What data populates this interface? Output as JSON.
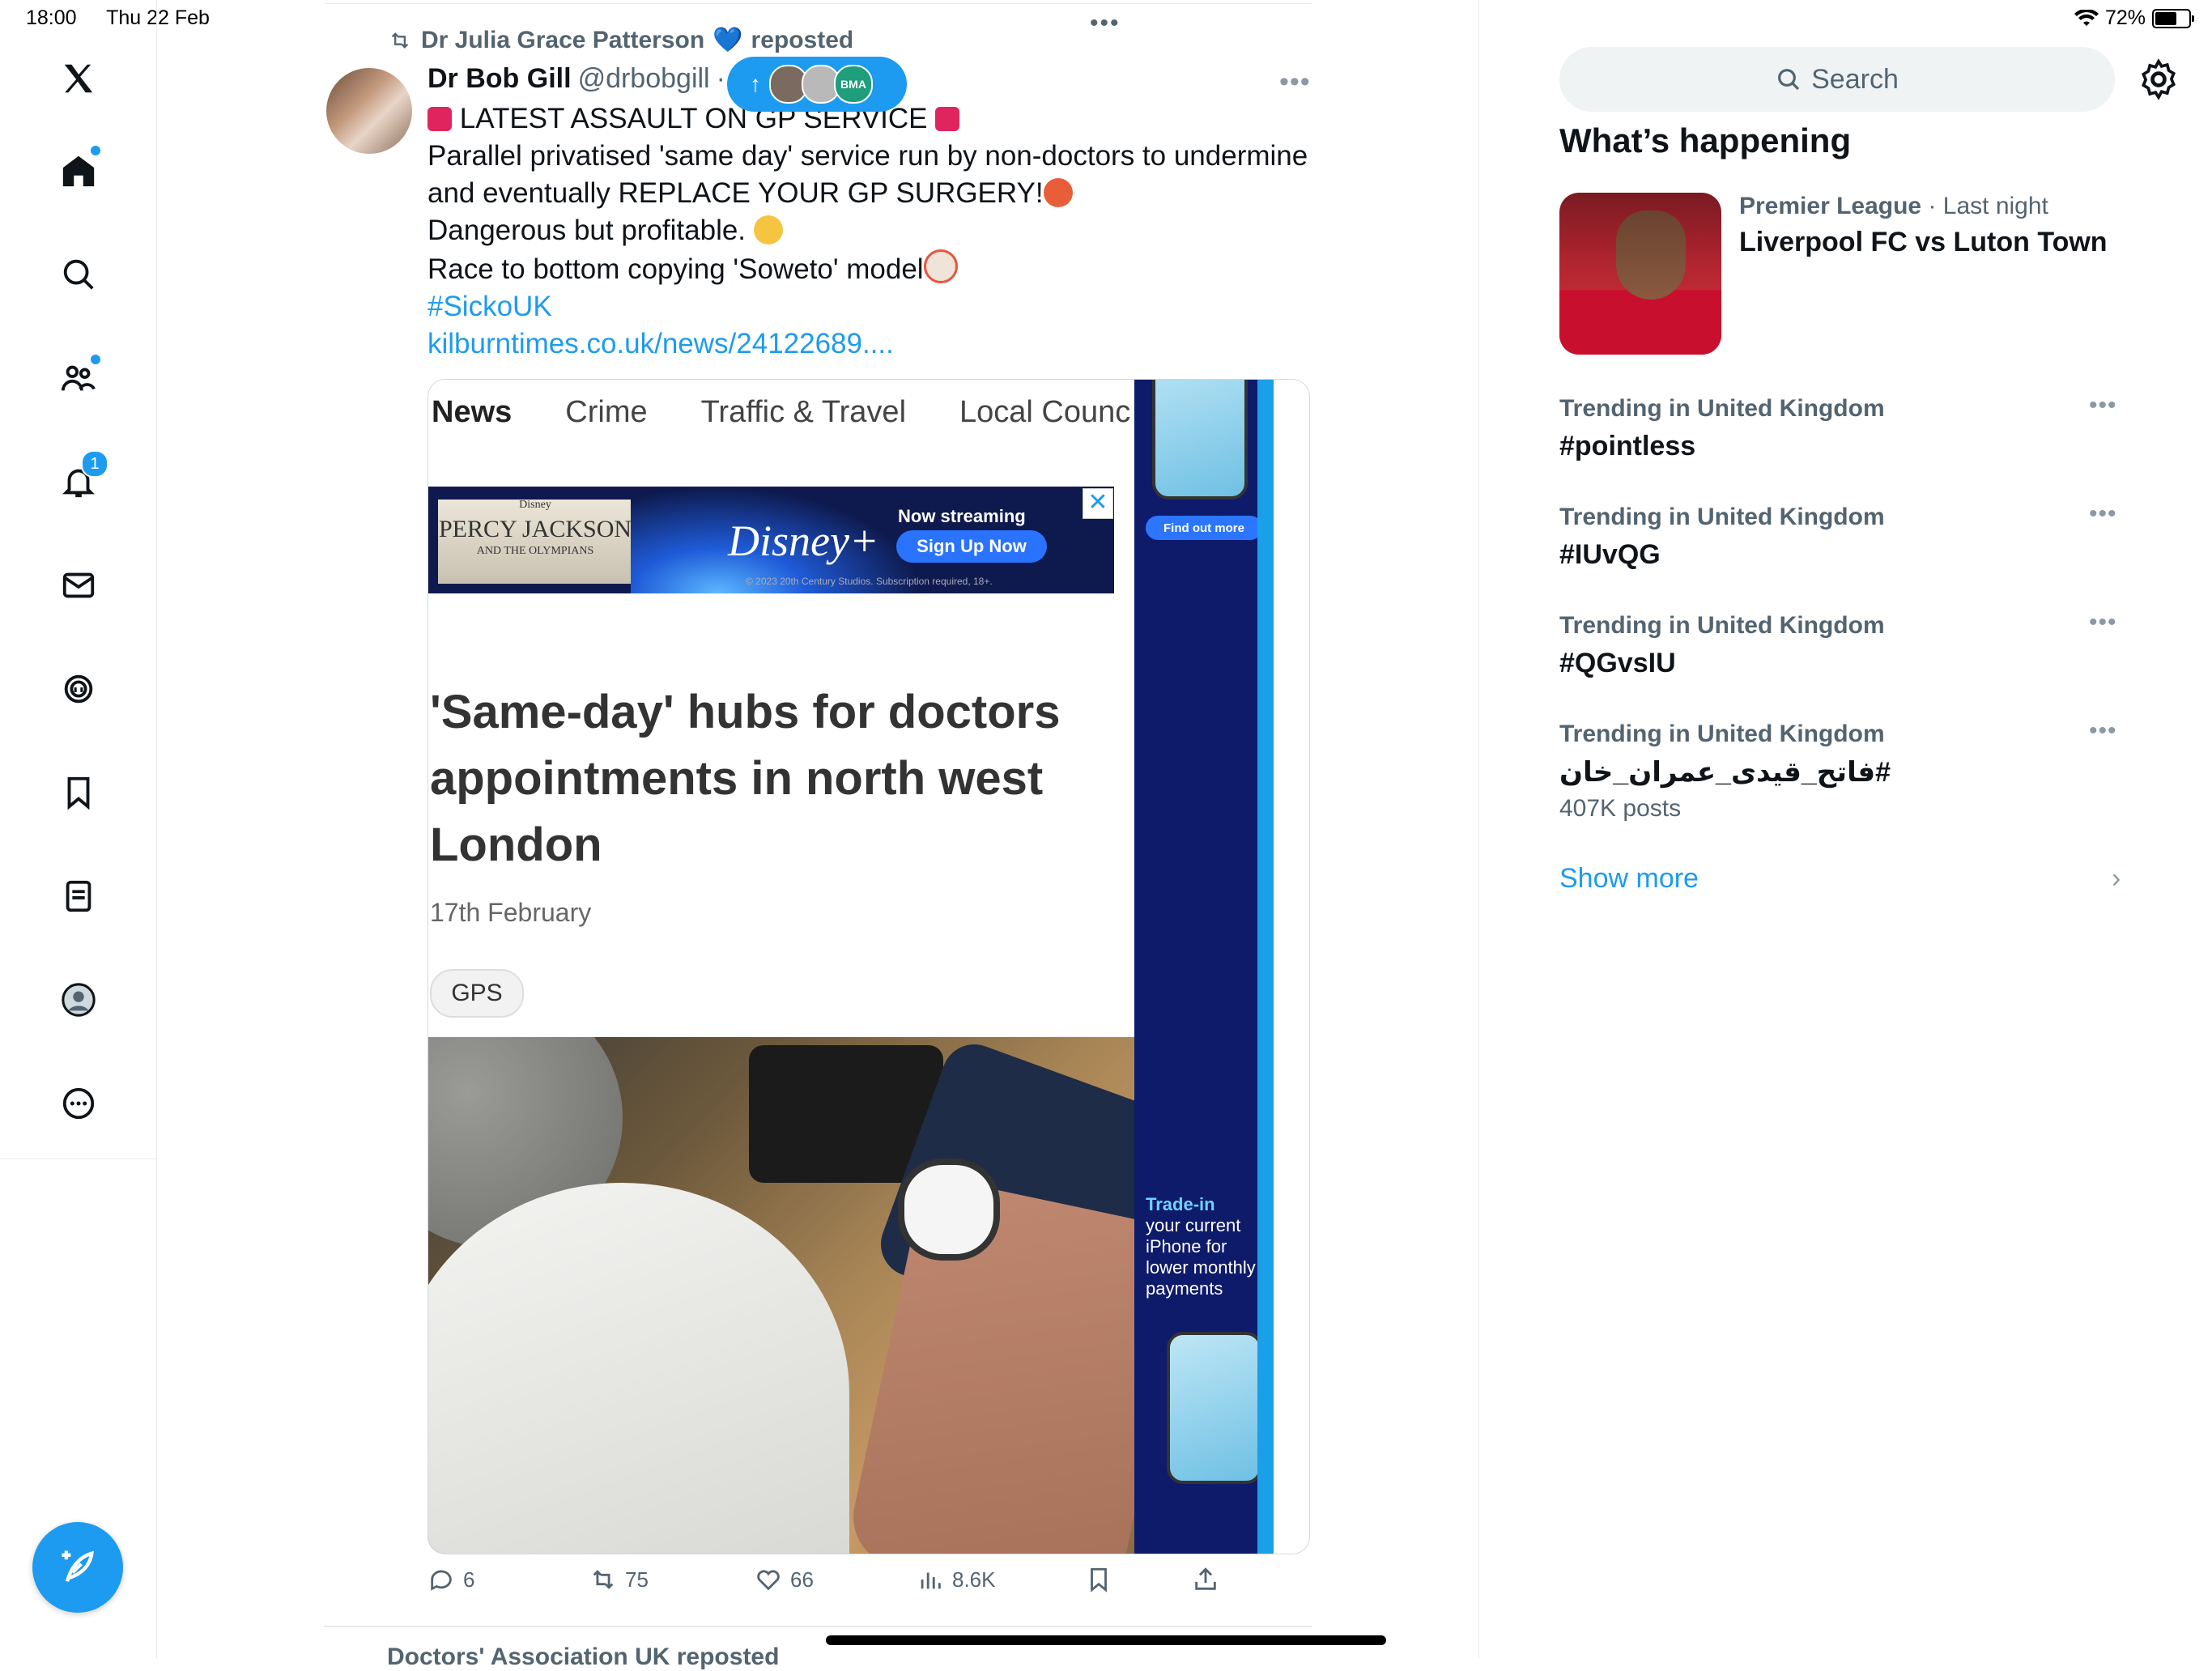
{
  "status_bar": {
    "time": "18:00",
    "date": "Thu 22 Feb",
    "battery_percent": "72%",
    "battery_level": 0.72
  },
  "nav": {
    "items": [
      {
        "name": "X logo",
        "icon": "x-logo-icon"
      },
      {
        "name": "Home",
        "icon": "home-icon",
        "dot": true
      },
      {
        "name": "Explore",
        "icon": "search-icon"
      },
      {
        "name": "Communities",
        "icon": "communities-icon",
        "dot": true
      },
      {
        "name": "Notifications",
        "icon": "bell-icon",
        "badge": "1"
      },
      {
        "name": "Messages",
        "icon": "mail-icon"
      },
      {
        "name": "Grok",
        "icon": "grok-icon"
      },
      {
        "name": "Bookmarks",
        "icon": "bookmark-icon"
      },
      {
        "name": "Lists",
        "icon": "lists-icon"
      },
      {
        "name": "Profile",
        "icon": "profile-icon"
      },
      {
        "name": "More",
        "icon": "more-circle-icon"
      }
    ],
    "compose_icon": "feather-plus-icon",
    "notification_badge": "1"
  },
  "tweet": {
    "reposted_by": "Dr Julia Grace Patterson",
    "reposted_label": "reposted",
    "author_name": "Dr Bob Gill",
    "author_handle": "@drbobgill",
    "author_dot": "· 1",
    "new_posts_pill_label": "BMA",
    "lines": [
      "LATEST ASSAULT ON GP SERVICE",
      "Parallel privatised 'same day' service run by non-doctors to undermine",
      "and eventually REPLACE YOUR GP SURGERY!",
      "Dangerous but profitable.",
      "Race to bottom copying 'Soweto' model"
    ],
    "hashtag": "#SickoUK",
    "link": "kilburntimes.co.uk/news/24122689....",
    "stats": {
      "replies": "6",
      "reposts": "75",
      "likes": "66",
      "views": "8.6K"
    }
  },
  "media": {
    "tabs": [
      "News",
      "Crime",
      "Traffic & Travel",
      "Local Counc"
    ],
    "ad": {
      "brand": "Disney+",
      "franchise": "PERCY JACKSON",
      "franchise_sub": "AND THE OLYMPIANS",
      "franchise_top": "Disney",
      "streaming": "Now streaming",
      "cta": "Sign Up Now",
      "fine_print": "© 2023 20th Century Studios. Subscription required, 18+.",
      "close": "✕"
    },
    "headline": "'Same-day' hubs for doctors appointments in north west London",
    "date": "17th February",
    "tag": "GPS",
    "side_ad": {
      "find_out_more": "Find out more",
      "trade_in_title": "Trade-in",
      "trade_in_text": "your current iPhone for lower monthly payments"
    }
  },
  "next_post": {
    "repost_text": "Doctors' Association UK reposted"
  },
  "right": {
    "search_placeholder": "Search",
    "header": "What’s happening",
    "event": {
      "category": "Premier League",
      "time": "· Last night",
      "title": "Liverpool FC vs Luton Town"
    },
    "trends": [
      {
        "meta": "Trending in United Kingdom",
        "name": "#pointless",
        "posts": ""
      },
      {
        "meta": "Trending in United Kingdom",
        "name": "#IUvQG",
        "posts": ""
      },
      {
        "meta": "Trending in United Kingdom",
        "name": "#QGvsIU",
        "posts": ""
      },
      {
        "meta": "Trending in United Kingdom",
        "name": "#فاتح_قیدی_عمران_خان",
        "posts": "407K posts"
      }
    ],
    "show_more": "Show more"
  },
  "colors": {
    "accent": "#1d9bf0",
    "text_primary": "#0f1419",
    "text_secondary": "#536471"
  }
}
